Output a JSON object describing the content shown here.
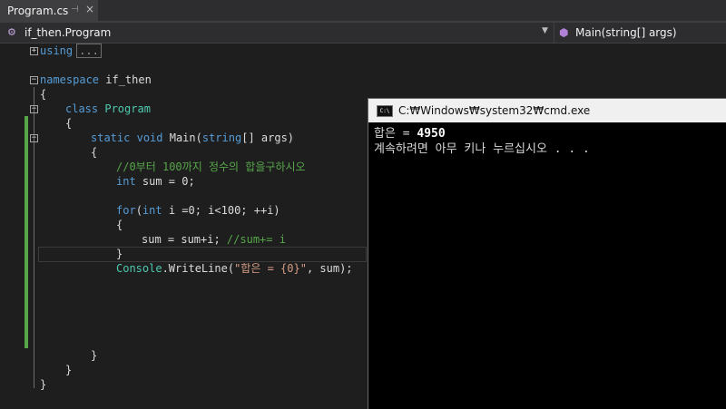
{
  "tab": {
    "title": "Program.cs",
    "pin_glyph": "⊣",
    "close_glyph": "×"
  },
  "navbar": {
    "class_path": "if_then.Program",
    "member": "Main(string[] args)"
  },
  "code": {
    "l1_kw": "using",
    "l1_collapsed": "...",
    "l3_kw": "namespace",
    "l3_name": " if_then",
    "l4": "{",
    "l5_kw": "class",
    "l5_name": "Program",
    "l6": "{",
    "l7_kw1": "static",
    "l7_kw2": "void",
    "l7_fn": " Main(",
    "l7_kw3": "string",
    "l7_rest": "[] args)",
    "l8": "{",
    "l9_comment": "//0부터 100까지 정수의 합을구하시오",
    "l10_kw": "int",
    "l10_rest": " sum = 0;",
    "l12_kw1": "for",
    "l12_mid": "(",
    "l12_kw2": "int",
    "l12_rest": " i =0; i<100; ++i)",
    "l13": "{",
    "l14_code": "sum = sum+i; ",
    "l14_comment": "//sum+= i",
    "l15": "}",
    "l16_type": "Console",
    "l16_mid": ".WriteLine(",
    "l16_str": "\"합은 = {0}\"",
    "l16_rest": ", sum);",
    "l22": "}",
    "l23": "}",
    "l24": "}"
  },
  "console": {
    "title": "C:₩Windows₩system32₩cmd.exe",
    "icon_text": "C:\\",
    "line1_label": "합은 = ",
    "line1_value": "4950",
    "line2": "계속하려면 아무 키나 누르십시오 . . ."
  },
  "colors": {
    "keyword": "#569cd6",
    "type": "#4ec9b0",
    "comment": "#57a64a",
    "string": "#d69d85",
    "change_bar": "#57a64a"
  }
}
